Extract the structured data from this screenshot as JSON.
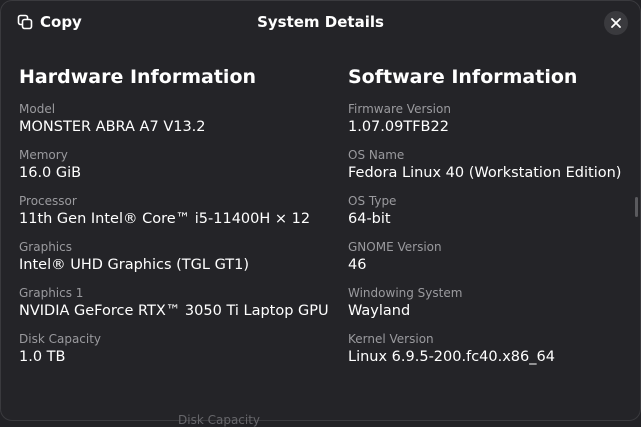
{
  "header": {
    "copy_label": "Copy",
    "title": "System Details",
    "copy_icon": "copy-icon",
    "close_icon": "close-icon"
  },
  "hardware": {
    "heading": "Hardware Information",
    "rows": [
      {
        "label": "Model",
        "value": "MONSTER ABRA A7 V13.2"
      },
      {
        "label": "Memory",
        "value": "16.0 GiB"
      },
      {
        "label": "Processor",
        "value": "11th Gen Intel® Core™ i5-11400H × 12"
      },
      {
        "label": "Graphics",
        "value": "Intel® UHD Graphics (TGL GT1)"
      },
      {
        "label": "Graphics 1",
        "value": "NVIDIA GeForce RTX™ 3050 Ti Laptop GPU"
      },
      {
        "label": "Disk Capacity",
        "value": "1.0 TB"
      }
    ]
  },
  "software": {
    "heading": "Software Information",
    "rows": [
      {
        "label": "Firmware Version",
        "value": "1.07.09TFB22"
      },
      {
        "label": "OS Name",
        "value": "Fedora Linux 40 (Workstation Edition)"
      },
      {
        "label": "OS Type",
        "value": "64-bit"
      },
      {
        "label": "GNOME Version",
        "value": "46"
      },
      {
        "label": "Windowing System",
        "value": "Wayland"
      },
      {
        "label": "Kernel Version",
        "value": "Linux 6.9.5-200.fc40.x86_64"
      }
    ]
  },
  "background": {
    "partial_text": "Disk Capacity"
  },
  "colors": {
    "window_bg": "#242428",
    "label_text": "#9a9a9e",
    "value_text": "#ffffff",
    "close_button_bg": "#3a3a3e"
  }
}
